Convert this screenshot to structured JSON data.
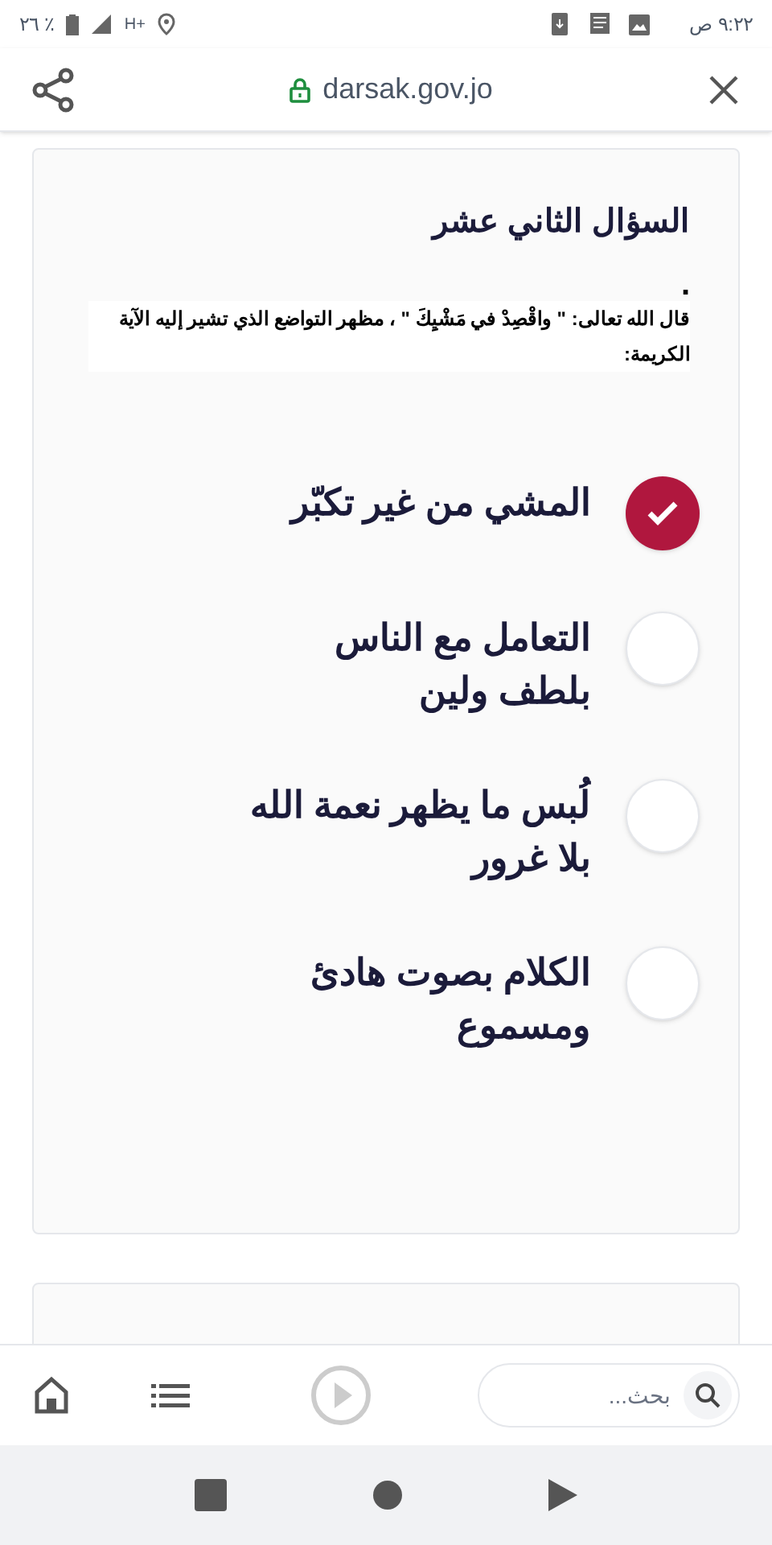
{
  "status_bar": {
    "time": "٩:٢٢ ص",
    "battery": "٢٦ ٪",
    "network": "H+"
  },
  "browser_bar": {
    "url": "darsak.gov.jo"
  },
  "question": {
    "title": "السؤال الثاني عشر",
    "mark": ".",
    "text": "قال الله تعالى: \" واقْصِدْ في مَشْيِكَ \" ، مظهر التواضع الذي تشير إليه الآية الكريمة:",
    "options": [
      {
        "label": "المشي من غير تكبّر",
        "selected": true
      },
      {
        "label": "التعامل مع الناس بلطف ولين",
        "selected": false
      },
      {
        "label": "لُبس ما يظهر نعمة الله بلا غرور",
        "selected": false
      },
      {
        "label": "الكلام بصوت هادئ ومسموع",
        "selected": false
      }
    ]
  },
  "bottom_bar": {
    "search": {
      "placeholder": "بحث..."
    }
  }
}
